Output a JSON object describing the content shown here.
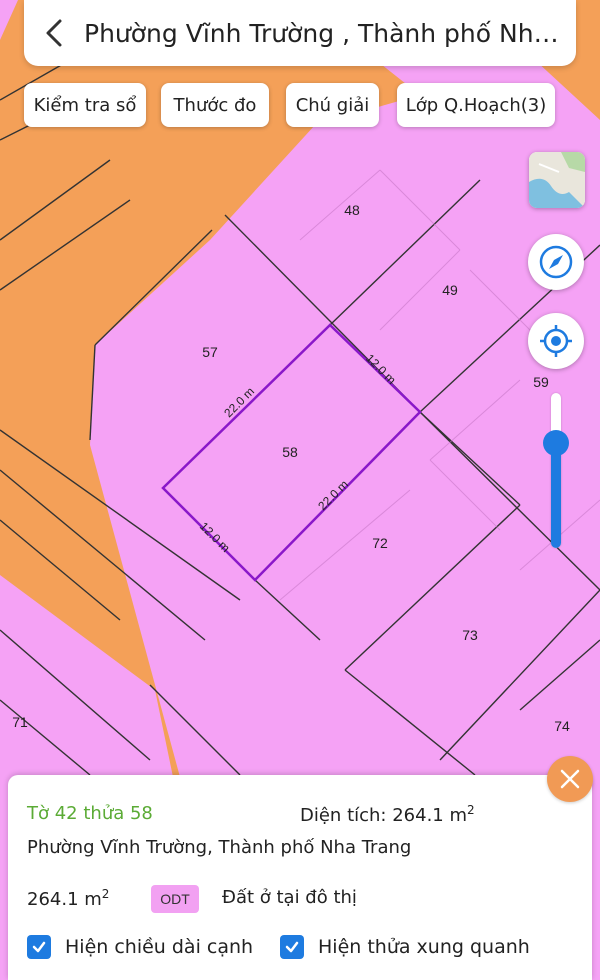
{
  "header": {
    "back_icon": "chevron-left-icon",
    "title": "Phường Vĩnh Trường , Thành phố Nha Tr..."
  },
  "toolbar": {
    "buttons": [
      {
        "label": "Kiểm tra sổ"
      },
      {
        "label": "Thước đo"
      },
      {
        "label": "Chú giải"
      },
      {
        "label": "Lớp Q.Hoạch(3)"
      }
    ]
  },
  "map_controls": {
    "layer_thumb_icon": "map-thumbnail-icon",
    "compass_icon": "compass-icon",
    "locate_icon": "gps-locate-icon",
    "zoom_level": "59"
  },
  "map": {
    "colors": {
      "land": "#f5a2f5",
      "road": "#f4a058",
      "outline": "#333333",
      "selected": "#8a18c9"
    },
    "parcels": [
      "48",
      "49",
      "57",
      "58",
      "72",
      "73",
      "71",
      "74"
    ],
    "edges": [
      "22.0 m",
      "12.0 m",
      "22.0 m",
      "12.0 m"
    ]
  },
  "sheet": {
    "close_icon": "close-icon",
    "parcel_id": "Tờ 42 thửa 58",
    "area_label": "Diện tích: 264.1 m",
    "area_sup": "2",
    "address": "Phường Vĩnh Trường, Thành phố Nha Trang",
    "area_value": "264.1 m",
    "area_value_sup": "2",
    "land_code": "ODT",
    "land_desc": "Đất ở tại đô thị",
    "checkboxes": [
      {
        "label": "Hiện chiều dài cạnh",
        "checked": true
      },
      {
        "label": "Hiện thửa xung quanh",
        "checked": true
      }
    ]
  }
}
